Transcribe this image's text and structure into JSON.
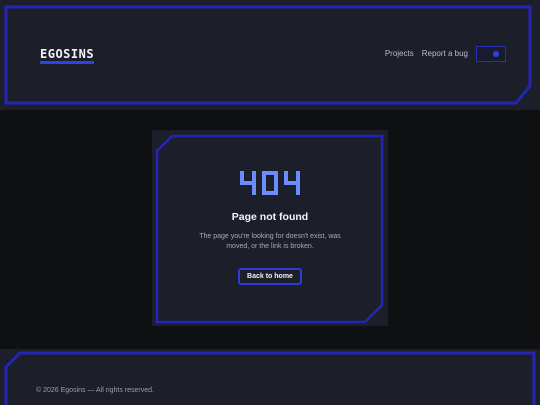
{
  "header": {
    "logo": "EGOSINS",
    "nav": {
      "projects": "Projects",
      "report_bug": "Report a bug"
    },
    "theme_toggle": {
      "state": "on"
    }
  },
  "error": {
    "code": "404",
    "title": "Page not found",
    "message": "The page you're looking for doesn't exist, was moved, or the link is broken.",
    "home_button": "Back to home"
  },
  "footer": {
    "copyright": "© 2026 Egosins — All rights reserved."
  },
  "colors": {
    "accent": "#2f42e6",
    "code": "#6b8cff",
    "panel": "#1c1e29",
    "background": "#0f1012"
  },
  "icons": [
    "toggle-knob-icon"
  ]
}
